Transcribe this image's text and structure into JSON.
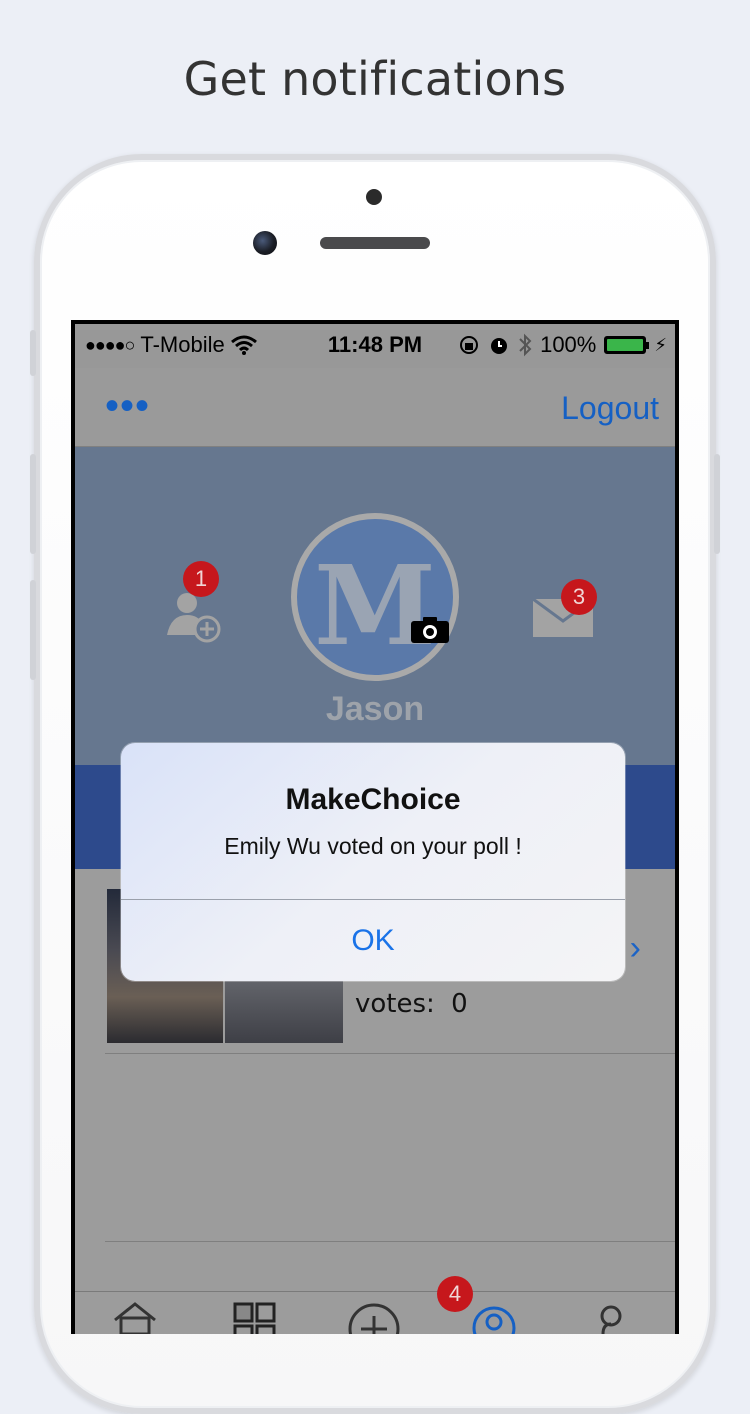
{
  "headline": "Get notifications",
  "statusbar": {
    "carrier": "T-Mobile",
    "time": "11:48 PM",
    "battery": "100%",
    "signal_dots": "●●●●○"
  },
  "navbar": {
    "menu_label": "•••",
    "logout_label": "Logout"
  },
  "profile": {
    "name": "Jason",
    "avatar_letter": "M",
    "friend_requests_badge": "1",
    "messages_badge": "3"
  },
  "poll": {
    "votes_label": "votes:",
    "votes_value": "0",
    "chevron": "›"
  },
  "tabbar": {
    "notifications_badge": "4"
  },
  "alert": {
    "title": "MakeChoice",
    "message": "Emily Wu voted on your poll !",
    "ok_label": "OK"
  },
  "colors": {
    "accent": "#1560c4",
    "badge": "#c6171c",
    "profile_bg": "#66778f",
    "band": "#2d4a8c"
  }
}
